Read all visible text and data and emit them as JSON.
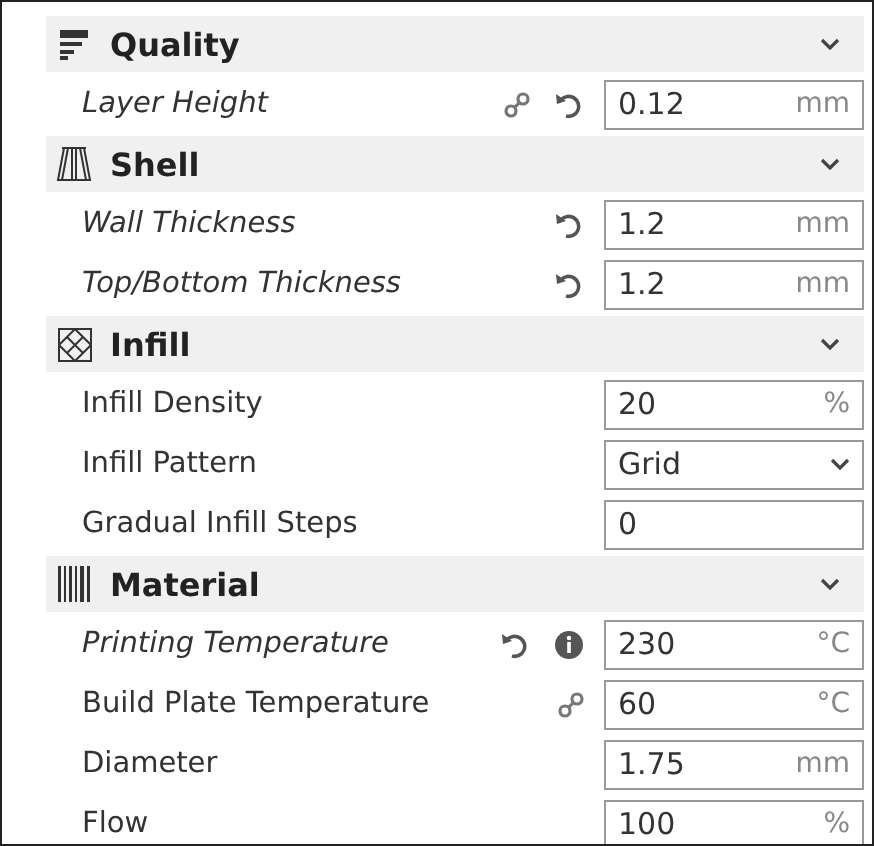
{
  "sections": [
    {
      "title": "Quality",
      "expanded": true,
      "settings": [
        {
          "label": "Layer Height",
          "modified": true,
          "linked": true,
          "resettable": true,
          "info": false,
          "field": {
            "kind": "number",
            "value": "0.12",
            "unit": "mm"
          }
        }
      ]
    },
    {
      "title": "Shell",
      "expanded": true,
      "settings": [
        {
          "label": "Wall Thickness",
          "modified": true,
          "linked": false,
          "resettable": true,
          "info": false,
          "field": {
            "kind": "number",
            "value": "1.2",
            "unit": "mm"
          }
        },
        {
          "label": "Top/Bottom Thickness",
          "modified": true,
          "linked": false,
          "resettable": true,
          "info": false,
          "field": {
            "kind": "number",
            "value": "1.2",
            "unit": "mm"
          }
        }
      ]
    },
    {
      "title": "Infill",
      "expanded": true,
      "settings": [
        {
          "label": "Infill Density",
          "modified": false,
          "linked": false,
          "resettable": false,
          "info": false,
          "field": {
            "kind": "number",
            "value": "20",
            "unit": "%"
          }
        },
        {
          "label": "Infill Pattern",
          "modified": false,
          "linked": false,
          "resettable": false,
          "info": false,
          "field": {
            "kind": "dropdown",
            "value": "Grid"
          }
        },
        {
          "label": "Gradual Infill Steps",
          "modified": false,
          "linked": false,
          "resettable": false,
          "info": false,
          "field": {
            "kind": "number",
            "value": "0"
          }
        }
      ]
    },
    {
      "title": "Material",
      "expanded": true,
      "settings": [
        {
          "label": "Printing Temperature",
          "modified": true,
          "linked": false,
          "resettable": true,
          "info": true,
          "field": {
            "kind": "number",
            "value": "230",
            "unit": "°C"
          }
        },
        {
          "label": "Build Plate Temperature",
          "modified": false,
          "linked": true,
          "resettable": false,
          "info": false,
          "field": {
            "kind": "number",
            "value": "60",
            "unit": "°C"
          }
        },
        {
          "label": "Diameter",
          "modified": false,
          "linked": false,
          "resettable": false,
          "info": false,
          "field": {
            "kind": "number",
            "value": "1.75",
            "unit": "mm"
          }
        },
        {
          "label": "Flow",
          "modified": false,
          "linked": false,
          "resettable": false,
          "info": false,
          "field": {
            "kind": "number",
            "value": "100",
            "unit": "%"
          }
        }
      ]
    }
  ]
}
